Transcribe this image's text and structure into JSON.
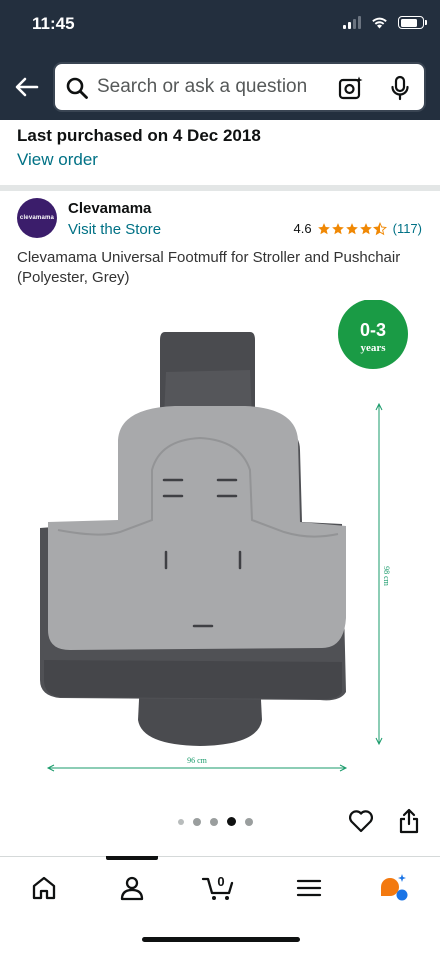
{
  "status_bar": {
    "time": "11:45"
  },
  "search": {
    "placeholder": "Search or ask a question"
  },
  "purchase": {
    "title": "Last purchased on 4 Dec 2018",
    "link": "View order"
  },
  "brand": {
    "logo_text": "clevamama",
    "name": "Clevamama",
    "store_link": "Visit the Store",
    "rating": "4.6",
    "rating_count": "(117)",
    "stars": 4.6
  },
  "product": {
    "title": "Clevamama Universal Footmuff for Stroller and Pushchair (Polyester, Grey)",
    "image": {
      "age_badge_main": "0-3",
      "age_badge_sub": "years",
      "height_label": "98 cm",
      "width_label": "96 cm"
    }
  },
  "carousel": {
    "count": 5,
    "active_index": 3
  },
  "nav": {
    "items": [
      "home-icon",
      "account-icon",
      "cart-icon",
      "menu-icon",
      "rufus-icon"
    ],
    "active": 1,
    "cart_count": "0"
  },
  "colors": {
    "header_bg": "#232f3e",
    "link": "#007185",
    "star": "#f08804",
    "badge_green": "#1a9b45",
    "dimension_line": "#1a9b6b"
  }
}
